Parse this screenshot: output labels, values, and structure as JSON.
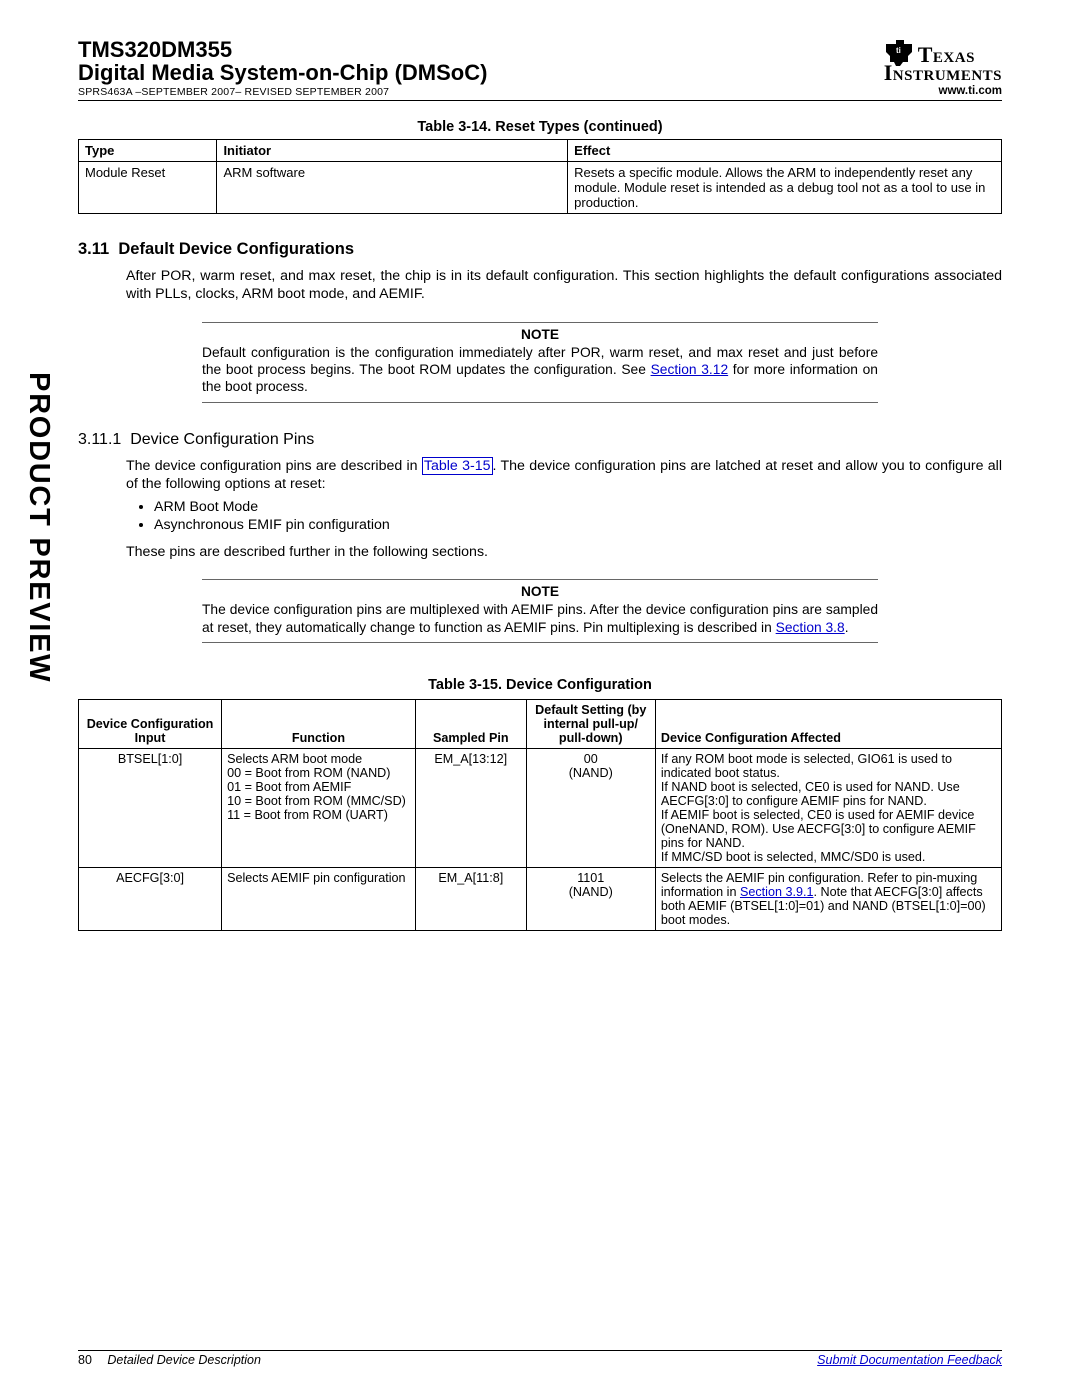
{
  "header": {
    "title": "TMS320DM355",
    "subtitle": "Digital Media System-on-Chip (DMSoC)",
    "docinfo": "SPRS463A –SEPTEMBER 2007– REVISED SEPTEMBER 2007",
    "url": "www.ti.com",
    "logo_top": "Texas",
    "logo_bot": "Instruments"
  },
  "table14": {
    "caption": "Table 3-14. Reset Types  (continued)",
    "headers": [
      "Type",
      "Initiator",
      "Effect"
    ],
    "row": {
      "type": "Module Reset",
      "initiator": "ARM software",
      "effect": "Resets a specific module. Allows the ARM to independently reset any module. Module reset is intended as a debug tool not as a tool to use in production."
    }
  },
  "sec311": {
    "num": "3.11",
    "title": "Default Device Configurations",
    "body": "After POR, warm reset, and max reset, the chip is in its default configuration. This section highlights the default configurations associated with PLLs, clocks, ARM boot mode, and AEMIF."
  },
  "note1": {
    "label": "NOTE",
    "text_pre": "Default configuration is the configuration immediately after POR, warm reset, and max reset and just before the boot process begins. The boot ROM updates the configuration. See ",
    "link": "Section 3.12",
    "text_post": " for more information on the boot process."
  },
  "sec3111": {
    "num": "3.11.1",
    "title": "Device  Configuration   Pins",
    "body_pre": "The device configuration pins are described in ",
    "link": "Table 3-15",
    "body_post": ". The device configuration pins are latched at reset and allow you to configure all of the following options at reset:",
    "bullets": [
      "ARM Boot Mode",
      "Asynchronous EMIF pin configuration"
    ],
    "after": "These pins are described further in the following sections."
  },
  "note2": {
    "label": "NOTE",
    "text_pre": "The device configuration pins are multiplexed with AEMIF pins. After the device configuration pins are sampled at reset, they automatically change to function as AEMIF pins. Pin multiplexing is described in ",
    "link": "Section 3.8",
    "text_post": "."
  },
  "table15": {
    "caption": "Table 3-15. Device Configuration",
    "headers": [
      "Device Configuration Input",
      "Function",
      "Sampled Pin",
      "Default Setting (by internal pull-up/ pull-down)",
      "Device Configuration Affected"
    ],
    "rows": [
      {
        "input": "BTSEL[1:0]",
        "function": "Selects ARM boot mode\n00 = Boot from ROM (NAND)\n01 = Boot from AEMIF\n10 = Boot from ROM (MMC/SD)\n11 = Boot from ROM (UART)",
        "sampled": "EM_A[13:12]",
        "default": "00\n(NAND)",
        "affected": "If any ROM boot mode is selected, GIO61 is used to indicated boot status.\nIf NAND boot is selected, CE0 is used for NAND. Use AECFG[3:0] to configure AEMIF pins for NAND.\nIf AEMIF boot is selected, CE0 is used for AEMIF device (OneNAND, ROM). Use AECFG[3:0] to configure AEMIF pins for NAND.\nIf MMC/SD boot is selected, MMC/SD0 is used."
      },
      {
        "input": "AECFG[3:0]",
        "function": "Selects AEMIF pin configuration",
        "sampled": "EM_A[11:8]",
        "default": "1101\n(NAND)",
        "affected_pre": "Selects the AEMIF pin configuration. Refer to pin-muxing information in ",
        "affected_link": "Section 3.9.1",
        "affected_post": ". Note that AECFG[3:0] affects both AEMIF (BTSEL[1:0]=01) and NAND (BTSEL[1:0]=00) boot modes."
      }
    ]
  },
  "footer": {
    "page": "80",
    "section": "Detailed Device Description",
    "feedback": "Submit Documentation Feedback"
  },
  "watermark": "PRODUCT PREVIEW"
}
